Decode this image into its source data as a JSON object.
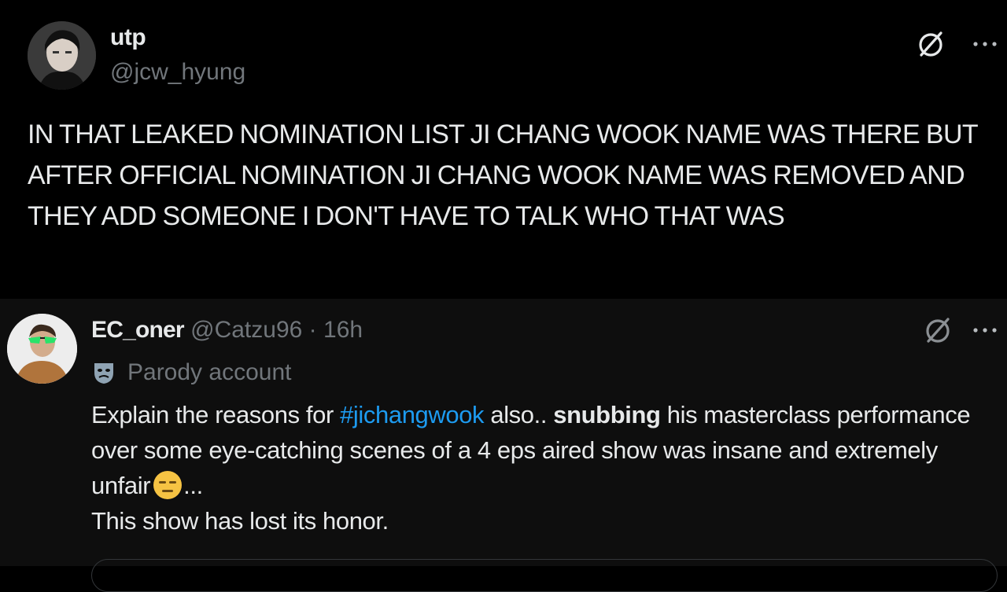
{
  "post": {
    "display_name": "utp",
    "handle": "@jcw_hyung",
    "text": "IN THAT LEAKED NOMINATION LIST JI CHANG WOOK NAME WAS THERE BUT AFTER OFFICIAL NOMINATION JI CHANG WOOK NAME WAS REMOVED AND THEY ADD SOMEONE I DON'T HAVE TO TALK WHO THAT WAS",
    "avatar_icon": "avatar-photo",
    "grok_icon": "grok-icon",
    "more_icon": "more-icon"
  },
  "reply": {
    "display_name": "EC_oner",
    "handle": "@Catzu96",
    "separator": "·",
    "time": "16h",
    "parody_label": "Parody account",
    "text_before_hashtag": "Explain the reasons for ",
    "hashtag": "#jichangwook",
    "text_after_hashtag": " also.. ",
    "bold_word": "snubbing",
    "text_after_bold": " his masterclass performance over some eye-catching scenes of a 4 eps aired show was insane and extremely unfair",
    "emoji": "expressionless-face",
    "text_after_emoji": "...",
    "second_line": "This show has lost its honor.",
    "avatar_icon": "avatar-photo",
    "mask_icon": "theater-mask-icon"
  },
  "colors": {
    "background": "#000000",
    "reply_background": "#0e0e0e",
    "text": "#e7e9ea",
    "muted": "#71767b",
    "link": "#1d9bf0"
  }
}
